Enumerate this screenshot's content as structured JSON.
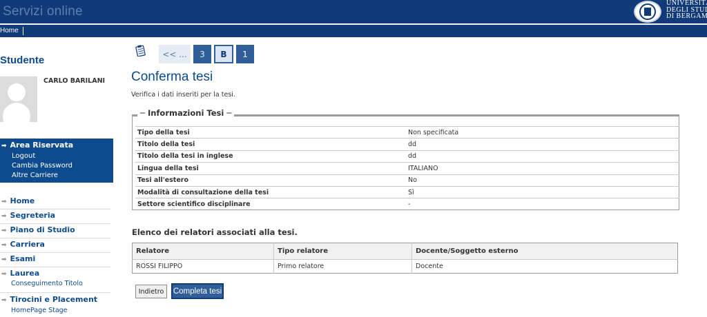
{
  "header": {
    "app_title": "Servizi online",
    "university_lines": [
      "UNIVERSITÀ",
      "DEGLI STUDI",
      "DI BERGAMO"
    ],
    "menu_home": "Home"
  },
  "sidebar": {
    "title": "Studente",
    "student_name": "CARLO BARILANI",
    "area": {
      "label": "Area Riservata",
      "items": [
        "Logout",
        "Cambia Password",
        "Altre Carriere"
      ]
    },
    "nav": [
      {
        "label": "Home"
      },
      {
        "label": "Segreteria"
      },
      {
        "label": "Piano di Studio"
      },
      {
        "label": "Carriera"
      },
      {
        "label": "Esami"
      },
      {
        "label": "Laurea",
        "sub": "Conseguimento Titolo"
      },
      {
        "label": "Tirocini e Placement",
        "sub": "HomePage Stage"
      }
    ]
  },
  "breadcrumb": {
    "back": "<< ...",
    "steps": [
      "3",
      "B",
      "1"
    ],
    "active_step": "B"
  },
  "main": {
    "title": "Conferma tesi",
    "subtitle": "Verifica i dati inseriti per la tesi.",
    "info_legend": "Informazioni Tesi",
    "info_rows": [
      {
        "label": "Tipo della tesi",
        "value": "Non specificata"
      },
      {
        "label": "Titolo della tesi",
        "value": "dd"
      },
      {
        "label": "Titolo della tesi in inglese",
        "value": "dd"
      },
      {
        "label": "Lingua della tesi",
        "value": "ITALIANO"
      },
      {
        "label": "Tesi all'estero",
        "value": "No"
      },
      {
        "label": "Modalità di consultazione della tesi",
        "value": "Sì"
      },
      {
        "label": "Settore scientifico disciplinare",
        "value": "-"
      }
    ],
    "relatori_title": "Elenco dei relatori associati alla tesi.",
    "relatori_headers": [
      "Relatore",
      "Tipo relatore",
      "Docente/Soggetto esterno"
    ],
    "relatori_rows": [
      [
        "ROSSI FILIPPO",
        "Primo relatore",
        "Docente"
      ]
    ],
    "buttons": {
      "back": "Indietro",
      "complete": "Completa tesi"
    }
  },
  "colors": {
    "header_bg": "#103a78",
    "accent": "#0e4b8e",
    "button_bg": "#2f5e98"
  }
}
